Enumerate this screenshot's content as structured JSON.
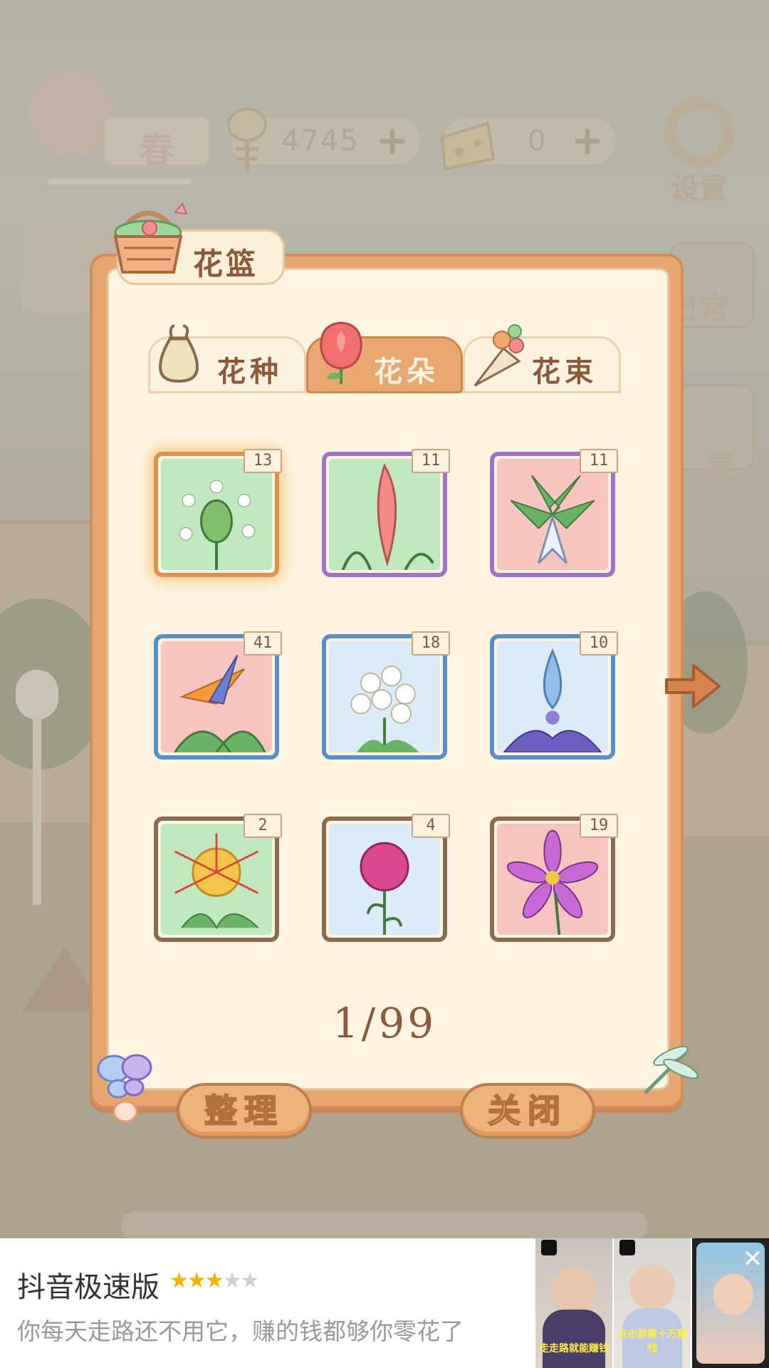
{
  "hud": {
    "season_label": "春",
    "coins": "4745",
    "cheese": "0",
    "plus_symbol": "+",
    "settings_label": "设置",
    "side_labels": [
      "日常",
      "建"
    ]
  },
  "panel": {
    "title": "花篮",
    "tabs": [
      {
        "label": "花种",
        "active": false
      },
      {
        "label": "花朵",
        "active": true
      },
      {
        "label": "花束",
        "active": false
      }
    ],
    "items": [
      {
        "count": "13",
        "bg": "#bfe8bf",
        "frame": "#e09050",
        "selected": true
      },
      {
        "count": "11",
        "bg": "#bfe8bf",
        "frame": "#a173c6",
        "selected": false
      },
      {
        "count": "11",
        "bg": "#f8c4c0",
        "frame": "#a173c6",
        "selected": false
      },
      {
        "count": "41",
        "bg": "#f8c4c0",
        "frame": "#5a8fc4",
        "selected": false
      },
      {
        "count": "18",
        "bg": "#dcebf8",
        "frame": "#5a8fc4",
        "selected": false
      },
      {
        "count": "10",
        "bg": "#dcebf8",
        "frame": "#5a8fc4",
        "selected": false
      },
      {
        "count": "2",
        "bg": "#bfe8bf",
        "frame": "#8a6a4f",
        "selected": false
      },
      {
        "count": "4",
        "bg": "#dcebf8",
        "frame": "#8a6a4f",
        "selected": false
      },
      {
        "count": "19",
        "bg": "#f8c4c0",
        "frame": "#8a6a4f",
        "selected": false
      }
    ],
    "page_indicator": "1/99",
    "sort_button": "整理",
    "close_button": "关闭"
  },
  "ad": {
    "app_name": "抖音极速版",
    "rating": 3,
    "max_rating": 5,
    "description": "你每天走路还不用它，赚的钱都够你零花了",
    "thumb_captions": [
      "走走路就能赚钱",
      "点击屏幕十万赚钱",
      ""
    ],
    "close_symbol": "✕"
  }
}
